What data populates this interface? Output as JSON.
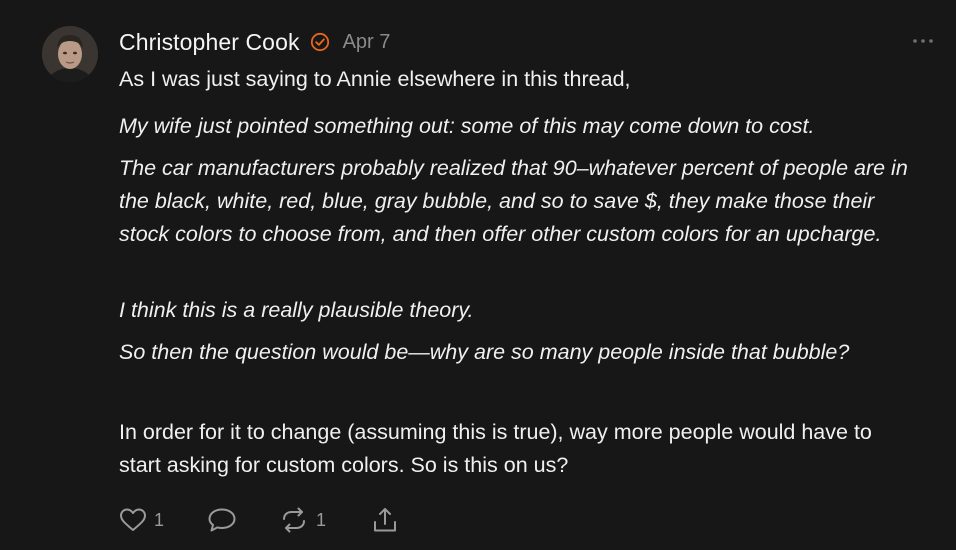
{
  "comment": {
    "author": "Christopher Cook",
    "date": "Apr 7",
    "paragraphs": [
      "As I was just saying to Annie elsewhere in this thread,",
      "My wife just pointed something out: some of this may come down to cost.",
      "The car manufacturers probably realized that 90–whatever percent of people are in the black, white, red, blue, gray bubble, and so to save $, they make those their stock colors to choose from, and then offer other custom colors for an upcharge.",
      "I think this is a really plausible theory.",
      "So then the question would be—why are so many people inside that bubble?",
      "In order for it to change (assuming this is true), way more people would have to start asking for custom colors. So is this on us?"
    ],
    "likes": "1",
    "restacks": "1"
  },
  "icons": {
    "verified": "verified-check-icon",
    "more": "more-dots-icon",
    "like": "heart-icon",
    "reply": "speech-bubble-icon",
    "restack": "restack-arrows-icon",
    "share": "share-icon"
  },
  "colors": {
    "background": "#171717",
    "verified_accent": "#e8661c",
    "muted": "#8a8a8a",
    "text": "#f0f0f0"
  }
}
